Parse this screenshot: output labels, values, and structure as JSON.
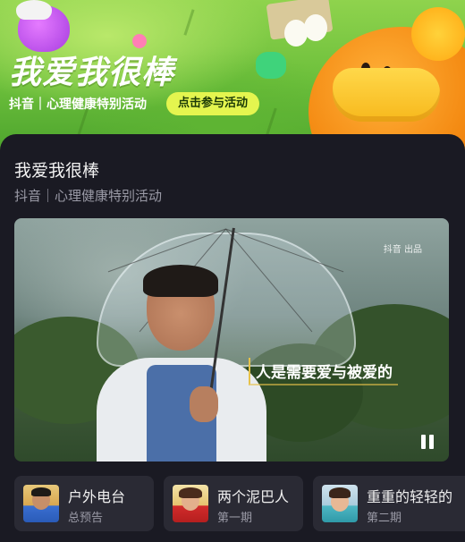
{
  "banner": {
    "title": "我爱我很棒",
    "subtitle": "抖音｜心理健康特别活动",
    "cta_label": "点击参与活动"
  },
  "card": {
    "title": "我爱我很棒",
    "subtitle": "抖音｜心理健康特别活动"
  },
  "video": {
    "logo": "抖音 出品",
    "caption": "人是需要爱与被爱的",
    "state": "playing"
  },
  "episodes": [
    {
      "title": "户外电台",
      "subtitle": "总预告"
    },
    {
      "title": "两个泥巴人",
      "subtitle": "第一期"
    },
    {
      "title": "重重的轻轻的",
      "subtitle": "第二期"
    }
  ],
  "colors": {
    "accent": "#e4f54f",
    "background": "#1a1a23",
    "card": "#2a2a34"
  }
}
